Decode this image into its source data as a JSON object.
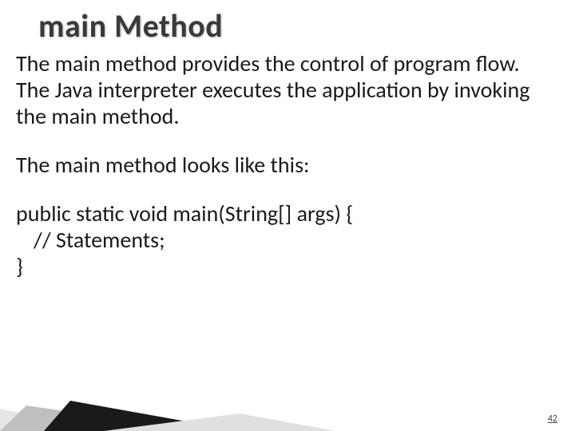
{
  "title": "main Method",
  "paragraph1": "The main method provides the control of program flow. The Java interpreter executes the application by invoking the main method.",
  "paragraph2": "The main method looks like this:",
  "code": {
    "line1": "public static void main(String[] args) {",
    "line2": "// Statements;",
    "line3": "}"
  },
  "page_number": "42"
}
